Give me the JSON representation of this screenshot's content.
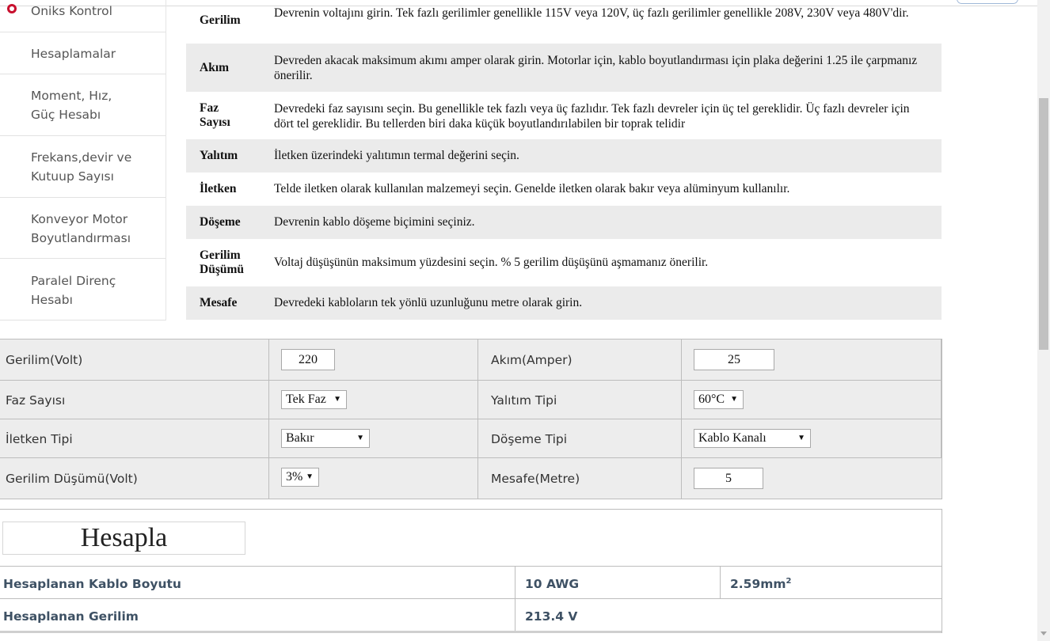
{
  "sidebar": {
    "items": [
      {
        "label": "Oniks Kontrol"
      },
      {
        "label": "Hesaplamalar"
      },
      {
        "label": "Moment, Hız, Güç Hesabı"
      },
      {
        "label": "Frekans,devir ve Kutuup Sayısı"
      },
      {
        "label": "Konveyor Motor Boyutlandırması"
      },
      {
        "label": "Paralel Direnç Hesabı"
      }
    ]
  },
  "info": {
    "rows": [
      {
        "label": "Gerilim",
        "desc": "Devrenin voltajını girin. Tek fazlı gerilimler genellikle 115V veya 120V, üç fazlı gerilimler genellikle 208V, 230V veya 480V'dir."
      },
      {
        "label": "Akım",
        "desc": "Devreden akacak maksimum akımı amper olarak girin. Motorlar için, kablo boyutlandırması için plaka değerini 1.25 ile çarpmanız önerilir."
      },
      {
        "label": "Faz Sayısı",
        "desc": "Devredeki faz sayısını seçin. Bu genellikle tek fazlı veya üç fazlıdır. Tek fazlı devreler için üç tel gereklidir. Üç fazlı devreler için dört tel gereklidir. Bu tellerden biri daka küçük boyutlandırılabilen bir toprak telidir"
      },
      {
        "label": "Yalıtım",
        "desc": "İletken üzerindeki yalıtımın termal değerini seçin."
      },
      {
        "label": "İletken",
        "desc": "Telde iletken olarak kullanılan malzemeyi seçin. Genelde iletken olarak bakır veya alüminyum kullanılır."
      },
      {
        "label": "Döşeme",
        "desc": "Devrenin kablo döşeme biçimini seçiniz."
      },
      {
        "label": "Gerilim Düşümü",
        "desc": "Voltaj düşüşünün maksimum yüzdesini seçin. % 5 gerilim düşüşünü aşmamanız önerilir."
      },
      {
        "label": "Mesafe",
        "desc": "Devredeki kabloların tek yönlü uzunluğunu metre olarak girin."
      }
    ]
  },
  "form": {
    "voltage_label": "Gerilim(Volt)",
    "voltage_value": "220",
    "current_label": "Akım(Amper)",
    "current_value": "25",
    "phase_label": "Faz Sayısı",
    "phase_value": "Tek Faz",
    "insulation_label": "Yalıtım Tipi",
    "insulation_value": "60°C",
    "conductor_label": "İletken Tipi",
    "conductor_value": "Bakır",
    "install_label": "Döşeme Tipi",
    "install_value": "Kablo Kanalı",
    "drop_label": "Gerilim Düşümü(Volt)",
    "drop_value": "3%",
    "distance_label": "Mesafe(Metre)",
    "distance_value": "5"
  },
  "results": {
    "button_label": "Hesapla",
    "cable_label": "Hesaplanan Kablo Boyutu",
    "cable_awg": "10 AWG",
    "cable_mm2": "2.59mm",
    "cable_mm2_sup": "2",
    "voltage_label": "Hesaplanan Gerilim",
    "voltage_value": "213.4 V"
  },
  "colors": {
    "result_text": "#3e5164",
    "shaded_row": "#ebebeb",
    "form_bg": "#ededed"
  }
}
